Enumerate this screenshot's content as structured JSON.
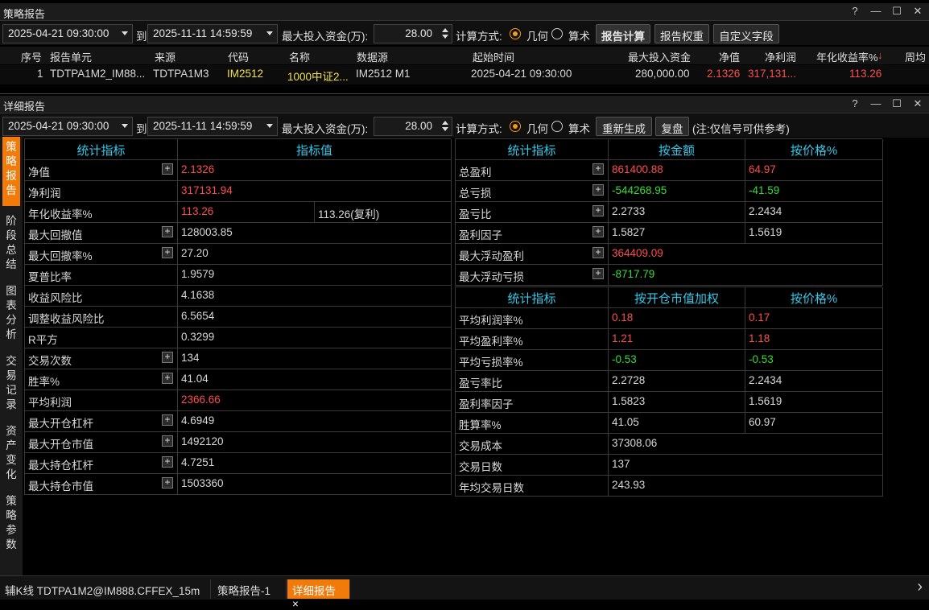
{
  "panel1": {
    "title": "策略报告",
    "start_time": "2025-04-21 09:30:00",
    "to_label": "到",
    "end_time": "2025-11-11 14:59:59",
    "max_fund_label": "最大投入资金(万):",
    "max_fund": "28.00",
    "calc_label": "计算方式:",
    "geo_label": "几何",
    "arith_label": "算术",
    "btn_calc": "报告计算",
    "btn_weight": "报告权重",
    "btn_custom": "自定义字段",
    "columns": [
      "序号",
      "报告单元",
      "来源",
      "代码",
      "名称",
      "数据源",
      "起始时间",
      "最大投入资金",
      "净值",
      "净利润",
      "年化收益率%",
      "周均"
    ],
    "sort_indicator": "↓",
    "row": {
      "idx": "1",
      "unit": "TDTPA1M2_IM88...",
      "source": "TDTPA1M3",
      "code": "IM2512",
      "name": "1000中证2...",
      "datasrc": "IM2512 M1",
      "start": "2025-04-21 09:30:00",
      "max_fund": "280,000.00",
      "nav": "2.1326",
      "net_profit": "317,131...",
      "annual": "113.26"
    }
  },
  "panel2": {
    "title": "详细报告",
    "start_time": "2025-04-21 09:30:00",
    "to_label": "到",
    "end_time": "2025-11-11 14:59:59",
    "max_fund_label": "最大投入资金(万):",
    "max_fund": "28.00",
    "calc_label": "计算方式:",
    "geo_label": "几何",
    "arith_label": "算术",
    "btn_regen": "重新生成",
    "btn_review": "复盘",
    "note": "(注:仅信号可供参考)"
  },
  "side_tabs": [
    "策\n略\n报\n告",
    "阶\n段\n总\n结",
    "图\n表\n分\n析",
    "交\n易\n记\n录",
    "资\n产\n变\n化",
    "策\n略\n参\n数"
  ],
  "left_table": {
    "h1": "统计指标",
    "h2": "指标值",
    "rows": [
      {
        "k": "净值",
        "v": "2.1326",
        "plus": true,
        "color": "red"
      },
      {
        "k": "净利润",
        "v": "317131.94",
        "plus": false,
        "color": "red"
      },
      {
        "k": "年化收益率%",
        "v": "113.26",
        "v2": "113.26(复利)",
        "plus": false,
        "color": "red"
      },
      {
        "k": "最大回撤值",
        "v": "128003.85",
        "plus": true,
        "color": ""
      },
      {
        "k": "最大回撤率%",
        "v": "27.20",
        "plus": true,
        "color": ""
      },
      {
        "k": "夏普比率",
        "v": "1.9579",
        "plus": false,
        "color": ""
      },
      {
        "k": "收益风险比",
        "v": "4.1638",
        "plus": false,
        "color": ""
      },
      {
        "k": "调整收益风险比",
        "v": "6.5654",
        "plus": false,
        "color": ""
      },
      {
        "k": "R平方",
        "v": "0.3299",
        "plus": false,
        "color": ""
      },
      {
        "k": "交易次数",
        "v": "134",
        "plus": true,
        "color": ""
      },
      {
        "k": "胜率%",
        "v": "41.04",
        "plus": true,
        "color": ""
      },
      {
        "k": "平均利润",
        "v": "2366.66",
        "plus": false,
        "color": "red"
      },
      {
        "k": "最大开仓杠杆",
        "v": "4.6949",
        "plus": true,
        "color": ""
      },
      {
        "k": "最大开仓市值",
        "v": "1492120",
        "plus": true,
        "color": ""
      },
      {
        "k": "最大持仓杠杆",
        "v": "4.7251",
        "plus": true,
        "color": ""
      },
      {
        "k": "最大持仓市值",
        "v": "1503360",
        "plus": true,
        "color": ""
      }
    ]
  },
  "right_table1": {
    "h1": "统计指标",
    "h2": "按金额",
    "h3": "按价格%",
    "rows": [
      {
        "k": "总盈利",
        "a": "861400.88",
        "p": "64.97",
        "ca": "red",
        "cp": "red"
      },
      {
        "k": "总亏损",
        "a": "-544268.95",
        "p": "-41.59",
        "ca": "green",
        "cp": "green"
      },
      {
        "k": "盈亏比",
        "a": "2.2733",
        "p": "2.2434",
        "ca": "",
        "cp": ""
      },
      {
        "k": "盈利因子",
        "a": "1.5827",
        "p": "1.5619",
        "ca": "",
        "cp": ""
      },
      {
        "k": "最大浮动盈利",
        "a": "364409.09",
        "p": "",
        "ca": "red",
        "cp": ""
      },
      {
        "k": "最大浮动亏损",
        "a": "-8717.79",
        "p": "",
        "ca": "green",
        "cp": ""
      }
    ]
  },
  "right_table2": {
    "h1": "统计指标",
    "h2": "按开仓市值加权",
    "h3": "按价格%",
    "rows": [
      {
        "k": "平均利润率%",
        "a": "0.18",
        "p": "0.17",
        "ca": "red",
        "cp": "red"
      },
      {
        "k": "平均盈利率%",
        "a": "1.21",
        "p": "1.18",
        "ca": "red",
        "cp": "red"
      },
      {
        "k": "平均亏损率%",
        "a": "-0.53",
        "p": "-0.53",
        "ca": "green",
        "cp": "green"
      },
      {
        "k": "盈亏率比",
        "a": "2.2728",
        "p": "2.2434",
        "ca": "",
        "cp": ""
      },
      {
        "k": "盈利率因子",
        "a": "1.5823",
        "p": "1.5619",
        "ca": "",
        "cp": ""
      },
      {
        "k": "胜算率%",
        "a": "41.05",
        "p": "60.97",
        "ca": "",
        "cp": ""
      },
      {
        "k": "交易成本",
        "a": "37308.06",
        "p": "",
        "ca": "",
        "cp": ""
      },
      {
        "k": "交易日数",
        "a": "137",
        "p": "",
        "ca": "",
        "cp": ""
      },
      {
        "k": "年均交易日数",
        "a": "243.93",
        "p": "",
        "ca": "",
        "cp": ""
      }
    ]
  },
  "bottom_tabs": [
    "辅K线 TDTPA1M2@IM888.CFFEX_15m",
    "策略报告-1",
    "详细报告"
  ],
  "close_glyph": "×",
  "arrow_glyph": "›",
  "colors": {
    "accent": "#f07a0a",
    "red": "#ff4d4d",
    "green": "#33dd33",
    "cyan": "#35c8e8",
    "yellow": "#f0e050"
  }
}
